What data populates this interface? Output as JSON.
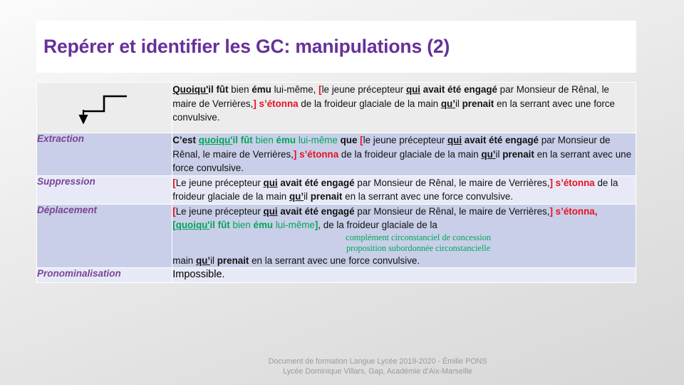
{
  "slide": {
    "title": "Repérer et identifier les GC: manipulations (2)"
  },
  "table": {
    "rows": [
      {
        "label": "",
        "icon": "step-arrow-icon",
        "segments": [
          {
            "t": "Quoiqu'",
            "s": "bu"
          },
          {
            "t": "il ",
            "s": "b"
          },
          {
            "t": "fût",
            "s": "b"
          },
          {
            "t": " bien ",
            "s": "plain"
          },
          {
            "t": "ému",
            "s": "b"
          },
          {
            "t": " lui-même, ",
            "s": "plain"
          },
          {
            "t": "[",
            "s": "red-br"
          },
          {
            "t": "le jeune précepteur ",
            "s": "plain"
          },
          {
            "t": "qui",
            "s": "bu"
          },
          {
            "t": " avait été engagé",
            "s": "b"
          },
          {
            "t": " par Monsieur de Rênal, le maire de Verrières,",
            "s": "plain"
          },
          {
            "t": "]",
            "s": "red-br"
          },
          {
            "t": " ",
            "s": "plain"
          },
          {
            "t": "s’étonna",
            "s": "red"
          },
          {
            "t": " de la froideur glaciale de la main ",
            "s": "plain"
          },
          {
            "t": "qu’",
            "s": "bu"
          },
          {
            "t": "il ",
            "s": "plain"
          },
          {
            "t": "prenait",
            "s": "b"
          },
          {
            "t": " en la serrant avec une force convulsive.",
            "s": "plain"
          }
        ]
      },
      {
        "label": "Extraction",
        "segments": [
          {
            "t": "C’est ",
            "s": "b"
          },
          {
            "t": "quoiqu'",
            "s": "green-bu"
          },
          {
            "t": "il ",
            "s": "green-b"
          },
          {
            "t": "fût",
            "s": "green-b"
          },
          {
            "t": " bien ",
            "s": "green"
          },
          {
            "t": "ému",
            "s": "green-b"
          },
          {
            "t": " lui-même",
            "s": "green"
          },
          {
            "t": " que ",
            "s": "b"
          },
          {
            "t": "[",
            "s": "red-br"
          },
          {
            "t": "le jeune précepteur ",
            "s": "plain"
          },
          {
            "t": "qui",
            "s": "bu"
          },
          {
            "t": " avait été engagé",
            "s": "b"
          },
          {
            "t": " par Monsieur de Rênal, le maire de Verrières,",
            "s": "plain"
          },
          {
            "t": "]",
            "s": "red-br"
          },
          {
            "t": " ",
            "s": "plain"
          },
          {
            "t": "s’étonna",
            "s": "red"
          },
          {
            "t": " de la froideur glaciale de la main ",
            "s": "plain"
          },
          {
            "t": "qu’",
            "s": "bu"
          },
          {
            "t": "il ",
            "s": "plain"
          },
          {
            "t": "prenait",
            "s": "b"
          },
          {
            "t": " en la serrant avec une force convulsive.",
            "s": "plain"
          }
        ]
      },
      {
        "label": "Suppression",
        "segments": [
          {
            "t": "[",
            "s": "red-br"
          },
          {
            "t": "Le jeune précepteur ",
            "s": "plain"
          },
          {
            "t": "qui",
            "s": "bu"
          },
          {
            "t": " avait été engagé",
            "s": "b"
          },
          {
            "t": " par Monsieur de Rênal, le maire de Verrières,",
            "s": "plain"
          },
          {
            "t": "]",
            "s": "red-br"
          },
          {
            "t": " ",
            "s": "plain"
          },
          {
            "t": "s’étonna",
            "s": "red"
          },
          {
            "t": " de la froideur glaciale de la main ",
            "s": "plain"
          },
          {
            "t": "qu’",
            "s": "bu"
          },
          {
            "t": "il ",
            "s": "plain"
          },
          {
            "t": "prenait",
            "s": "b"
          },
          {
            "t": " en la serrant avec une force convulsive.",
            "s": "plain"
          }
        ]
      },
      {
        "label": "Déplacement",
        "segments_before": [
          {
            "t": "[",
            "s": "red-br"
          },
          {
            "t": "Le jeune précepteur ",
            "s": "plain"
          },
          {
            "t": "qui",
            "s": "bu"
          },
          {
            "t": " avait été engagé",
            "s": "b"
          },
          {
            "t": " par Monsieur de Rênal, le maire de Verrières,",
            "s": "plain"
          },
          {
            "t": "]",
            "s": "red-br"
          },
          {
            "t": " ",
            "s": "plain"
          },
          {
            "t": "s’étonna,",
            "s": "red"
          },
          {
            "t": " ",
            "s": "plain"
          },
          {
            "t": "[",
            "s": "green-br"
          },
          {
            "t": "quoiqu'",
            "s": "green-bu"
          },
          {
            "t": "il ",
            "s": "green-b"
          },
          {
            "t": "fût",
            "s": "green-b"
          },
          {
            "t": " bien ",
            "s": "green"
          },
          {
            "t": "ému",
            "s": "green-b"
          },
          {
            "t": " lui-même",
            "s": "green"
          },
          {
            "t": "]",
            "s": "green-br"
          },
          {
            "t": ", de la froideur glaciale de la",
            "s": "plain"
          }
        ],
        "annotation_1": "complément circonstanciel de concession",
        "annotation_2": "proposition subordonnée circonstancielle",
        "segments_after": [
          {
            "t": " main ",
            "s": "plain"
          },
          {
            "t": "qu’",
            "s": "bu"
          },
          {
            "t": "il ",
            "s": "plain"
          },
          {
            "t": "prenait",
            "s": "b"
          },
          {
            "t": " en la serrant avec une force convulsive.",
            "s": "plain"
          }
        ]
      },
      {
        "label": "Pronominalisation",
        "plain_text": "Impossible."
      }
    ]
  },
  "footer": {
    "line1": "Document de formation Langue Lycée  2019-2020 - Émilie PONS",
    "line2": "Lycée Dominique Villars, Gap, Académie d’Aix-Marseille"
  },
  "colors": {
    "title_purple": "#67309a",
    "label_purple": "#7b4397",
    "accent_red": "#e81123",
    "accent_green": "#00a65a",
    "row_light_gray": "#ececec",
    "row_lavender_dark": "#c9cfe8",
    "row_lavender_light": "#e7eaf6"
  }
}
